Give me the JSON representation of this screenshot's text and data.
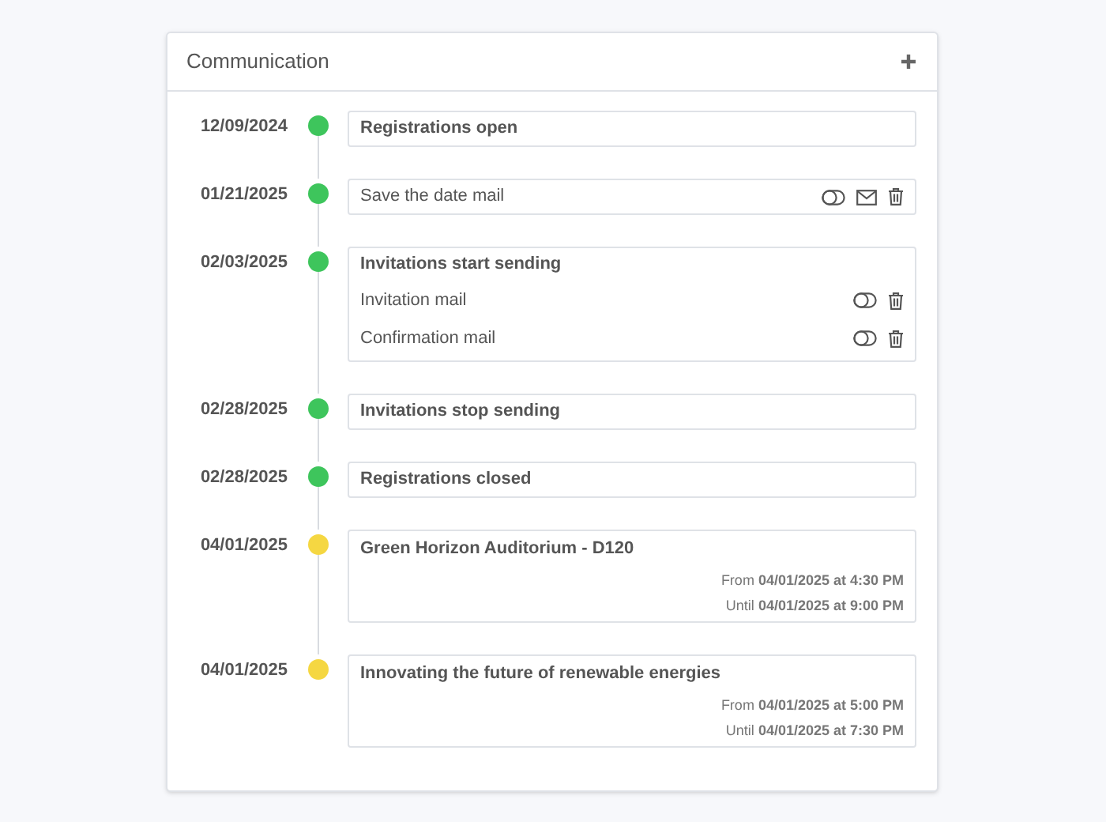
{
  "panel": {
    "title": "Communication"
  },
  "timeline": [
    {
      "date": "12/09/2024",
      "color": "#3ec55c",
      "kind": "milestone",
      "title": "Registrations open"
    },
    {
      "date": "01/21/2025",
      "color": "#3ec55c",
      "kind": "mail",
      "title": "Save the date mail",
      "actions": [
        {
          "kind": "toggle"
        },
        {
          "kind": "email"
        },
        {
          "kind": "delete"
        }
      ]
    },
    {
      "date": "02/03/2025",
      "color": "#3ec55c",
      "kind": "milestone",
      "title": "Invitations start sending",
      "mails": [
        {
          "title": "Invitation mail",
          "actions": [
            {
              "kind": "toggle"
            },
            {
              "kind": "delete"
            }
          ]
        },
        {
          "title": "Confirmation mail",
          "actions": [
            {
              "kind": "toggle"
            },
            {
              "kind": "delete"
            }
          ]
        }
      ]
    },
    {
      "date": "02/28/2025",
      "color": "#3ec55c",
      "kind": "milestone",
      "title": "Invitations stop sending"
    },
    {
      "date": "02/28/2025",
      "color": "#3ec55c",
      "kind": "milestone",
      "title": "Registrations closed"
    },
    {
      "date": "04/01/2025",
      "color": "#f5d742",
      "kind": "session",
      "title": "Green Horizon Auditorium - D120",
      "from": "From **04/01/2025 at 4:30 PM**",
      "until": "Until **04/01/2025 at 9:00 PM**"
    },
    {
      "date": "04/01/2025",
      "color": "#f5d742",
      "kind": "session",
      "title": "Innovating the future of renewable energies",
      "from": "From **04/01/2025 at 5:00 PM**",
      "until": "Until **04/01/2025 at 7:30 PM**"
    }
  ]
}
